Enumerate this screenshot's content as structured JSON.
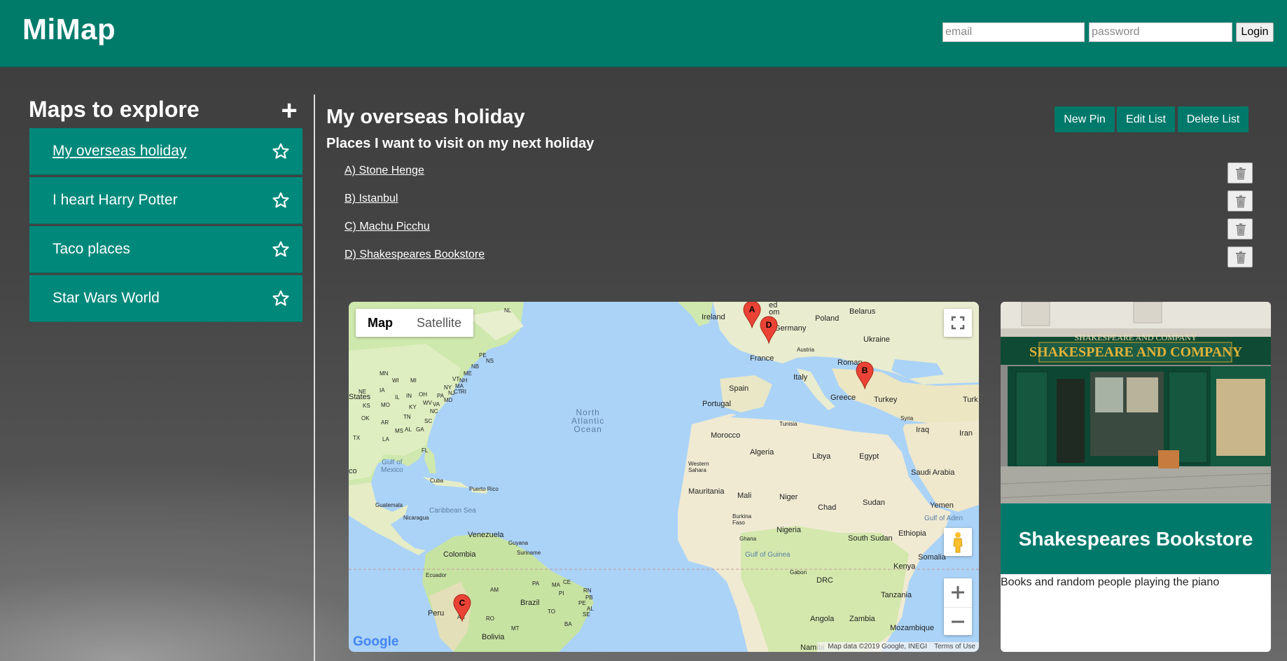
{
  "header": {
    "logo": "MiMap",
    "email_placeholder": "email",
    "password_placeholder": "password",
    "login_label": "Login"
  },
  "sidebar": {
    "title": "Maps to explore",
    "add_label": "+",
    "items": [
      {
        "label": "My overseas holiday",
        "active": true
      },
      {
        "label": "I heart Harry Potter",
        "active": false
      },
      {
        "label": "Taco places",
        "active": false
      },
      {
        "label": "Star Wars World",
        "active": false
      }
    ]
  },
  "main": {
    "title": "My overseas holiday",
    "subtitle": "Places I want to visit on my next holiday",
    "buttons": {
      "new_pin": "New Pin",
      "edit_list": "Edit List",
      "delete_list": "Delete List"
    },
    "pins": [
      {
        "label": "A) Stone Henge"
      },
      {
        "label": "B) Istanbul"
      },
      {
        "label": "C) Machu Picchu"
      },
      {
        "label": "D) Shakespeares Bookstore"
      }
    ]
  },
  "map": {
    "type_map": "Map",
    "type_satellite": "Satellite",
    "google": "Google",
    "attribution": "Map data ©2019 Google, INEGI",
    "terms": "Terms of Use",
    "markers": [
      "A",
      "B",
      "C",
      "D"
    ],
    "labels": {
      "ireland": "Ireland",
      "kingdom": "ed\nom",
      "germany": "Germany",
      "poland": "Poland",
      "belarus": "Belarus",
      "ukraine": "Ukraine",
      "austria": "Austria",
      "france": "France",
      "romania": "Roman",
      "italy": "Italy",
      "spain": "Spain",
      "portugal": "Portugal",
      "greece": "Greece",
      "turkey": "Turkey",
      "turk": "Turk",
      "syria": "Syria",
      "iraq": "Iraq",
      "iran": "Iran",
      "tunisia": "Tunisia",
      "morocco": "Morocco",
      "algeria": "Algeria",
      "libya": "Libya",
      "egypt": "Egypt",
      "saudi": "Saudi Arabia",
      "western_sahara": "Western\nSahara",
      "mauritania": "Mauritania",
      "mali": "Mali",
      "niger": "Niger",
      "chad": "Chad",
      "sudan": "Sudan",
      "yemen": "Yemen",
      "gulf_aden": "Gulf of Aden",
      "burkina": "Burkina\nFaso",
      "nigeria": "Nigeria",
      "ghana": "Ghana",
      "gulf_guinea": "Gulf of Guinea",
      "south_sudan": "South Sudan",
      "ethiopia": "Ethiopia",
      "somalia": "Somalia",
      "kenya": "Kenya",
      "gabon": "Gabon",
      "drc": "DRC",
      "tanzania": "Tanzania",
      "angola": "Angola",
      "zambia": "Zambia",
      "mozambique": "Mozambique",
      "namibia": "Namibi",
      "north_atlantic": "North\nAtlantic\nOcean",
      "states": "States",
      "gulf_mexico": "Gulf of\nMexico",
      "cuba": "Cuba",
      "puerto_rico": "Puerto Rico",
      "caribbean": "Caribbean Sea",
      "guatemala": "Guatemala",
      "nicaragua": "Nicaragua",
      "venezuela": "Venezuela",
      "guyana": "Guyana",
      "suriname": "Suriname",
      "colombia": "Colombia",
      "ecuador": "Ecuador",
      "peru": "Peru",
      "brazil": "Brazil",
      "bolivia": "Bolivia",
      "am": "AM",
      "pa": "PA",
      "ma": "MA",
      "ce": "CE",
      "pi": "PI",
      "to": "TO",
      "ba": "BA",
      "rn": "RN",
      "pb": "PB",
      "pe": "PE",
      "al": "AL",
      "se": "SE",
      "mt": "MT",
      "ro": "RO",
      "ac": "AC",
      "co": "co",
      "nl": "NL",
      "pe_can": "PE",
      "ns": "NS",
      "nb": "NB",
      "me": "ME",
      "vt": "VT",
      "ny": "NY",
      "ma_us": "MA",
      "pa_us": "PA",
      "oh": "OH",
      "in": "IN",
      "il": "IL",
      "wi": "WI",
      "mi": "MI",
      "ia": "IA",
      "mo": "MO",
      "ks": "KS",
      "ok": "OK",
      "tx": "TX",
      "ar": "AR",
      "la": "LA",
      "ms": "MS",
      "al_us": "AL",
      "ga": "GA",
      "fl": "FL",
      "sc": "SC",
      "nc": "NC",
      "tn": "TN",
      "ky": "KY",
      "wv": "WV",
      "va": "VA",
      "md": "MD",
      "nj": "NJ",
      "ct": "CT",
      "ri": "RI",
      "nh": "NH",
      "mn": "MN",
      "ne": "NE"
    }
  },
  "card": {
    "title": "Shakespeares Bookstore",
    "description": "Books and random people playing the piano",
    "sign_text_top": "SHAKESPEARE AND COMPANY",
    "sign_text_main": "SHAKESPEARE AND COMPANY"
  },
  "colors": {
    "header": "#007b6a",
    "sidebar_item": "#00897b",
    "button": "#00796b",
    "land": "#f0edd6",
    "green_land": "#cbe6a3",
    "water": "#abd3f7",
    "marker": "#ea4335"
  }
}
